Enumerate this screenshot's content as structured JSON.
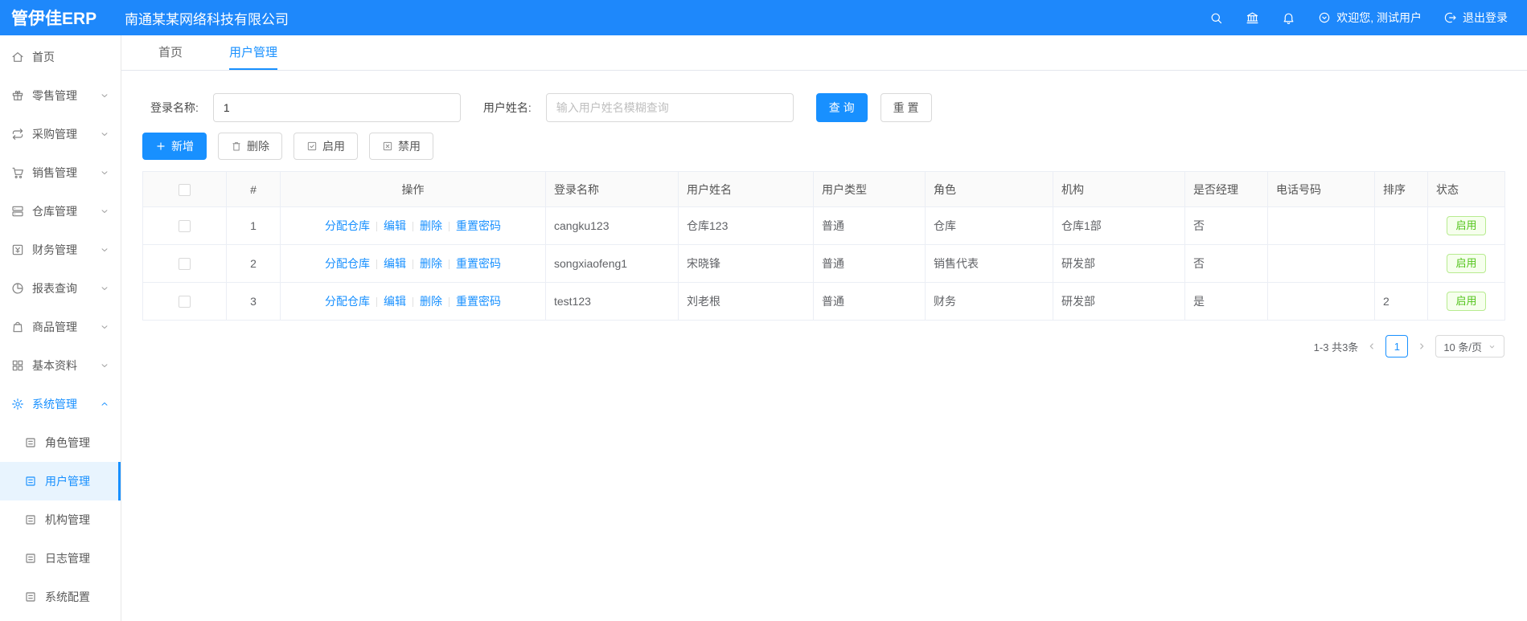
{
  "topbar": {
    "logo": "管伊佳ERP",
    "company": "南通某某网络科技有限公司",
    "welcome": "欢迎您, 测试用户",
    "logout": "退出登录"
  },
  "sidebar": {
    "items": [
      {
        "label": "首页",
        "icon": "home",
        "expandable": false,
        "expanded": false,
        "active": false
      },
      {
        "label": "零售管理",
        "icon": "retail",
        "expandable": true,
        "expanded": false,
        "active": false
      },
      {
        "label": "采购管理",
        "icon": "purchase",
        "expandable": true,
        "expanded": false,
        "active": false
      },
      {
        "label": "销售管理",
        "icon": "sales",
        "expandable": true,
        "expanded": false,
        "active": false
      },
      {
        "label": "仓库管理",
        "icon": "warehouse",
        "expandable": true,
        "expanded": false,
        "active": false
      },
      {
        "label": "财务管理",
        "icon": "finance",
        "expandable": true,
        "expanded": false,
        "active": false
      },
      {
        "label": "报表查询",
        "icon": "report",
        "expandable": true,
        "expanded": false,
        "active": false
      },
      {
        "label": "商品管理",
        "icon": "product",
        "expandable": true,
        "expanded": false,
        "active": false
      },
      {
        "label": "基本资料",
        "icon": "basic",
        "expandable": true,
        "expanded": false,
        "active": false
      },
      {
        "label": "系统管理",
        "icon": "system",
        "expandable": true,
        "expanded": true,
        "active": true
      }
    ],
    "subitems": [
      {
        "label": "角色管理",
        "active": false
      },
      {
        "label": "用户管理",
        "active": true
      },
      {
        "label": "机构管理",
        "active": false
      },
      {
        "label": "日志管理",
        "active": false
      },
      {
        "label": "系统配置",
        "active": false
      }
    ]
  },
  "tabs": [
    {
      "label": "首页",
      "active": false
    },
    {
      "label": "用户管理",
      "active": true
    }
  ],
  "filters": {
    "login_name_label": "登录名称:",
    "login_name_value": "1",
    "user_name_label": "用户姓名:",
    "user_name_placeholder": "输入用户姓名模糊查询",
    "search_button": "查 询",
    "reset_button": "重 置"
  },
  "toolbar": {
    "add": "新增",
    "delete": "删除",
    "enable": "启用",
    "disable": "禁用"
  },
  "table": {
    "headers": [
      "#",
      "操作",
      "登录名称",
      "用户姓名",
      "用户类型",
      "角色",
      "机构",
      "是否经理",
      "电话号码",
      "排序",
      "状态"
    ],
    "action_links": [
      "分配仓库",
      "编辑",
      "删除",
      "重置密码"
    ],
    "rows": [
      {
        "index": "1",
        "login": "cangku123",
        "name": "仓库123",
        "type": "普通",
        "role": "仓库",
        "org": "仓库1部",
        "manager": "否",
        "phone": "",
        "sort": "",
        "status": "启用"
      },
      {
        "index": "2",
        "login": "songxiaofeng1",
        "name": "宋晓锋",
        "type": "普通",
        "role": "销售代表",
        "org": "研发部",
        "manager": "否",
        "phone": "",
        "sort": "",
        "status": "启用"
      },
      {
        "index": "3",
        "login": "test123",
        "name": "刘老根",
        "type": "普通",
        "role": "财务",
        "org": "研发部",
        "manager": "是",
        "phone": "",
        "sort": "2",
        "status": "启用"
      }
    ]
  },
  "pagination": {
    "total": "1-3 共3条",
    "page": "1",
    "page_size": "10 条/页"
  },
  "colors": {
    "topbar_bg": "#1e88fb",
    "primary": "#1890ff",
    "status_green": "#52c41a",
    "status_green_border": "#b7eb8f",
    "status_green_bg": "#f6ffed",
    "active_menu_bg": "#e8f4fe"
  }
}
